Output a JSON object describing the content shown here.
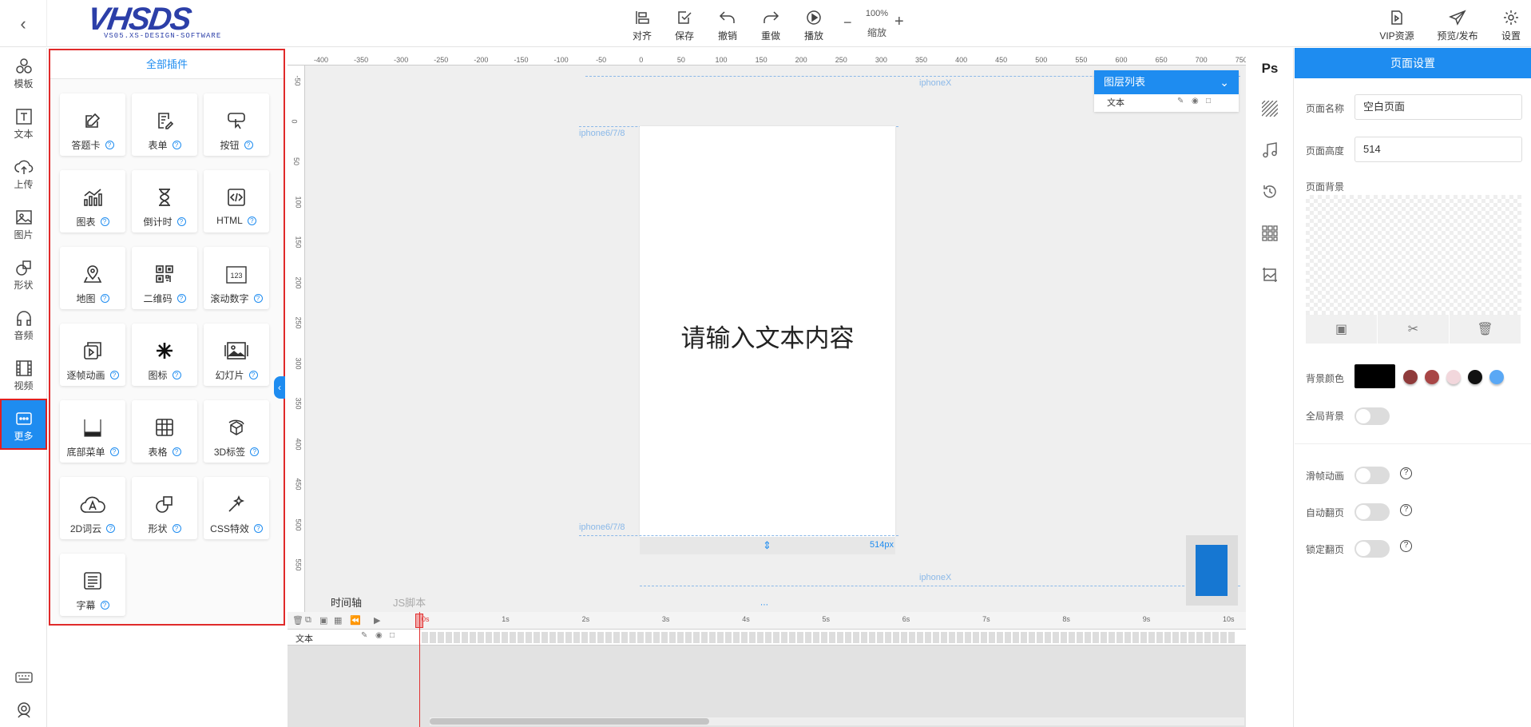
{
  "topbar": {
    "logo_text": "VHSDS",
    "logo_sub": "VS05.XS-DESIGN-SOFTWARE",
    "align_label": "对齐",
    "save_label": "保存",
    "undo_label": "撤销",
    "redo_label": "重做",
    "play_label": "播放",
    "zoom_value": "100%",
    "zoom_label": "缩放",
    "vip_label": "VIP资源",
    "preview_label": "预览/发布",
    "settings_label": "设置"
  },
  "leftnav": {
    "items": [
      {
        "label": "模板",
        "icon": "template-icon"
      },
      {
        "label": "文本",
        "icon": "text-icon"
      },
      {
        "label": "上传",
        "icon": "upload-icon"
      },
      {
        "label": "图片",
        "icon": "image-icon"
      },
      {
        "label": "形状",
        "icon": "shape-icon"
      },
      {
        "label": "音频",
        "icon": "audio-icon"
      },
      {
        "label": "视频",
        "icon": "video-icon"
      },
      {
        "label": "更多",
        "icon": "more-icon"
      }
    ],
    "active": "更多"
  },
  "plugins": {
    "title": "全部插件",
    "items": [
      {
        "label": "答题卡",
        "icon": "edit-icon"
      },
      {
        "label": "表单",
        "icon": "form-icon"
      },
      {
        "label": "按钮",
        "icon": "button-icon"
      },
      {
        "label": "图表",
        "icon": "chart-icon"
      },
      {
        "label": "倒计时",
        "icon": "hourglass-icon"
      },
      {
        "label": "HTML",
        "icon": "code-icon"
      },
      {
        "label": "地图",
        "icon": "map-pin-icon"
      },
      {
        "label": "二维码",
        "icon": "qrcode-icon"
      },
      {
        "label": "滚动数字",
        "icon": "number-icon"
      },
      {
        "label": "逐帧动画",
        "icon": "frame-animation-icon"
      },
      {
        "label": "图标",
        "icon": "asterisk-icon"
      },
      {
        "label": "幻灯片",
        "icon": "slideshow-icon"
      },
      {
        "label": "底部菜单",
        "icon": "bottom-menu-icon"
      },
      {
        "label": "表格",
        "icon": "table-icon"
      },
      {
        "label": "3D标签",
        "icon": "cube-icon"
      },
      {
        "label": "2D词云",
        "icon": "word-cloud-icon"
      },
      {
        "label": "形状",
        "icon": "shape-icon"
      },
      {
        "label": "CSS特效",
        "icon": "magic-wand-icon"
      },
      {
        "label": "字幕",
        "icon": "subtitle-icon"
      }
    ]
  },
  "canvas": {
    "h_ruler": [
      "-400",
      "-350",
      "-300",
      "-250",
      "-200",
      "-150",
      "-100",
      "-50",
      "0",
      "50",
      "100",
      "150",
      "200",
      "250",
      "300",
      "350",
      "400",
      "450",
      "500",
      "550",
      "600",
      "650",
      "700",
      "750"
    ],
    "v_ruler": [
      "-50",
      "0",
      "50",
      "100",
      "150",
      "200",
      "250",
      "300",
      "350",
      "400",
      "450",
      "500",
      "550"
    ],
    "page_text": "请输入文本内容",
    "guide_iphonex": "iphoneX",
    "guide_iphone678": "iphone6/7/8",
    "page_height_label": "514px"
  },
  "layers": {
    "title": "图层列表",
    "rows": [
      {
        "name": "文本"
      }
    ]
  },
  "timeline": {
    "tabs": [
      "时间轴",
      "JS脚本"
    ],
    "marks": [
      "0s",
      "1s",
      "2s",
      "3s",
      "4s",
      "5s",
      "6s",
      "7s",
      "8s",
      "9s",
      "10s"
    ],
    "rows": [
      {
        "name": "文本"
      }
    ]
  },
  "settings": {
    "title": "页面设置",
    "page_name_label": "页面名称",
    "page_name_value": "空白页面",
    "page_height_label": "页面高度",
    "page_height_value": "514",
    "page_bg_label": "页面背景",
    "bg_color_label": "背景颜色",
    "global_bg_label": "全局背景",
    "slide_anim_label": "滑帧动画",
    "auto_flip_label": "自动翻页",
    "lock_flip_label": "锁定翻页",
    "swatches": [
      "#8f3b3b",
      "#a84646",
      "#f2d7dc",
      "#111111",
      "#5aa8f5"
    ],
    "bg_color_value": "#000000"
  }
}
